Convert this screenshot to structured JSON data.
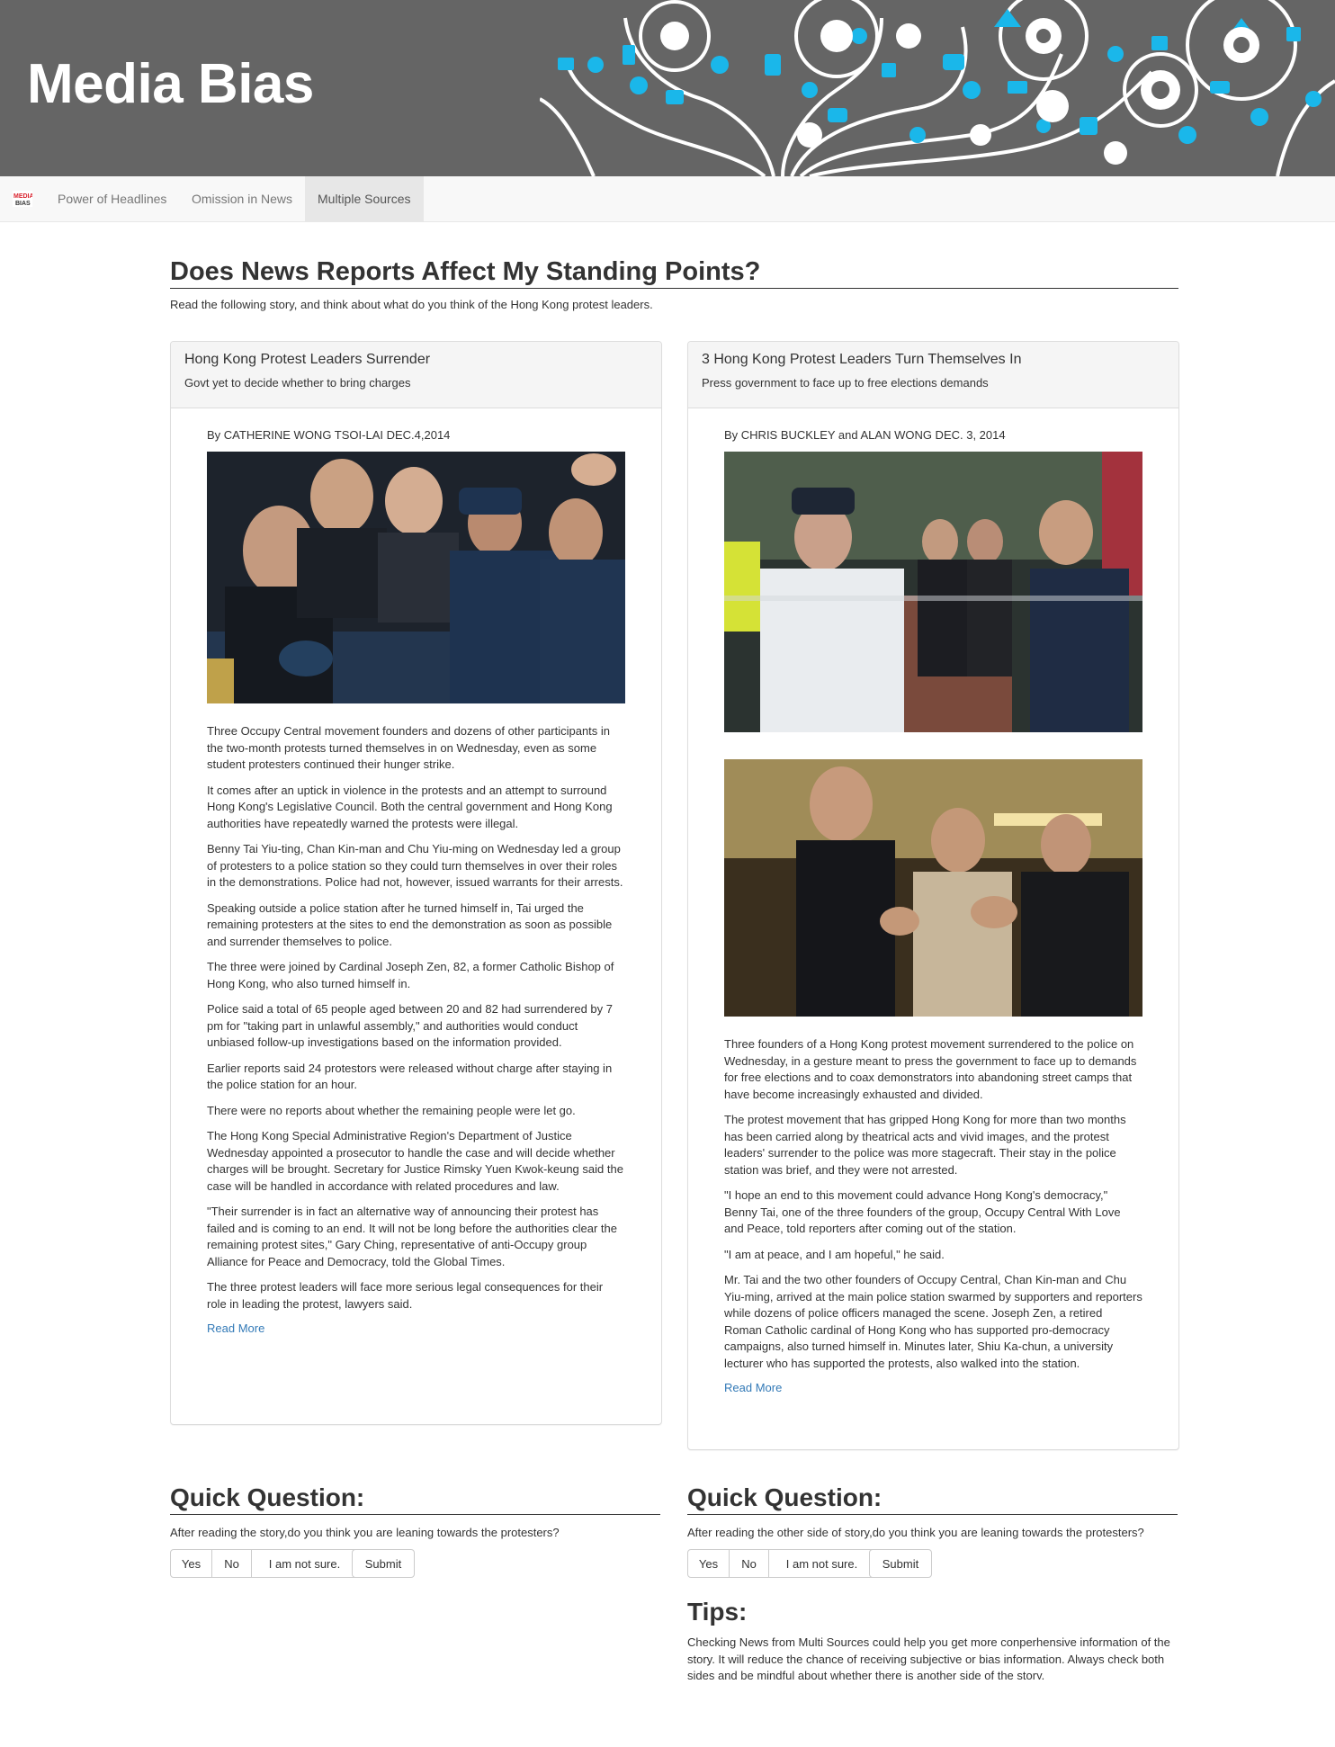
{
  "banner": {
    "title": "Media Bias"
  },
  "navbar": {
    "logo_icon": "media-bias-logo-icon",
    "items": [
      {
        "label": "Power of Headlines",
        "active": false
      },
      {
        "label": "Omission in News",
        "active": false
      },
      {
        "label": "Multiple Sources",
        "active": true
      }
    ]
  },
  "main": {
    "heading": "Does News Reports Affect My Standing Points?",
    "intro": "Read the following story, and think about what do you think of the Hong Kong protest leaders."
  },
  "articles": [
    {
      "title": "Hong Kong Protest Leaders Surrender",
      "subtitle": "Govt yet to decide whether to bring charges",
      "byline": "By CATHERINE WONG TSOI-LAI DEC.4,2014",
      "paragraphs": [
        "Three Occupy Central movement founders and dozens of other participants in the two-month protests turned themselves in on Wednesday, even as some student protesters continued their hunger strike.",
        "It comes after an uptick in violence in the protests and an attempt to surround Hong Kong's Legislative Council. Both the central government and Hong Kong authorities have repeatedly warned the protests were illegal.",
        "Benny Tai Yiu-ting, Chan Kin-man and Chu Yiu-ming on Wednesday led a group of protesters to a police station so they could turn themselves in over their roles in the demonstrations. Police had not, however, issued warrants for their arrests.",
        "Speaking outside a police station after he turned himself in, Tai urged the remaining protesters at the sites to end the demonstration as soon as possible and surrender themselves to police.",
        "The three were joined by Cardinal Joseph Zen, 82, a former Catholic Bishop of Hong Kong, who also turned himself in.",
        "Police said a total of 65 people aged between 20 and 82 had surrendered by 7 pm for \"taking part in unlawful assembly,\" and authorities would conduct unbiased follow-up investigations based on the information provided.",
        "Earlier reports said 24 protestors were released without charge after staying in the police station for an hour.",
        "There were no reports about whether the remaining people were let go.",
        "The Hong Kong Special Administrative Region's Department of Justice Wednesday appointed a prosecutor to handle the case and will decide whether charges will be brought. Secretary for Justice Rimsky Yuen Kwok-keung said the case will be handled in accordance with related procedures and law.",
        "\"Their surrender is in fact an alternative way of announcing their protest has failed and is coming to an end. It will not be long before the authorities clear the remaining protest sites,\" Gary Ching, representative of anti-Occupy group Alliance for Peace and Democracy, told the Global Times.",
        "The three protest leaders will face more serious legal consequences for their role in leading the protest, lawyers said."
      ],
      "read_more": "Read More"
    },
    {
      "title": "3 Hong Kong Protest Leaders Turn Themselves In",
      "subtitle": "Press government to face up to free elections demands",
      "byline": "By CHRIS BUCKLEY and ALAN WONG DEC. 3, 2014",
      "paragraphs": [
        "Three founders of a Hong Kong protest movement surrendered to the police on Wednesday, in a gesture meant to press the government to face up to demands for free elections and to coax demonstrators into abandoning street camps that have become increasingly exhausted and divided.",
        "The protest movement that has gripped Hong Kong for more than two months has been carried along by theatrical acts and vivid images, and the protest leaders' surrender to the police was more stagecraft. Their stay in the police station was brief, and they were not arrested.",
        "\"I hope an end to this movement could advance Hong Kong's democracy,\" Benny Tai, one of the three founders of the group, Occupy Central With Love and Peace, told reporters after coming out of the station.",
        "\"I am at peace, and I am hopeful,\" he said.",
        "Mr. Tai and the two other founders of Occupy Central, Chan Kin-man and Chu Yiu-ming, arrived at the main police station swarmed by supporters and reporters while dozens of police officers managed the scene. Joseph Zen, a retired Roman Catholic cardinal of Hong Kong who has supported pro-democracy campaigns, also turned himself in. Minutes later, Shiu Ka-chun, a university lecturer who has supported the protests, also walked into the station."
      ],
      "read_more": "Read More"
    }
  ],
  "quick_questions": [
    {
      "heading": "Quick Question:",
      "question": "After reading the story,do you think you are leaning towards the protesters?",
      "options": [
        "Yes",
        "No",
        "I am not sure."
      ],
      "submit": "Submit"
    },
    {
      "heading": "Quick Question:",
      "question": "After reading the other side of story,do you think you are leaning towards the protesters?",
      "options": [
        "Yes",
        "No",
        "I am not sure."
      ],
      "submit": "Submit"
    }
  ],
  "tips": {
    "heading": "Tips:",
    "text": "Checking News from Multi Sources could help you get more conperhensive information of the story. It will reduce the chance of receiving subjective or bias information. Always check both sides and be mindful about whether there is another side of the story."
  },
  "colors": {
    "banner_bg": "#656565",
    "icon_cyan": "#1ab7ea",
    "link": "#337ab7",
    "navbar_bg": "#f8f8f8",
    "active_nav_bg": "#e7e7e7"
  }
}
